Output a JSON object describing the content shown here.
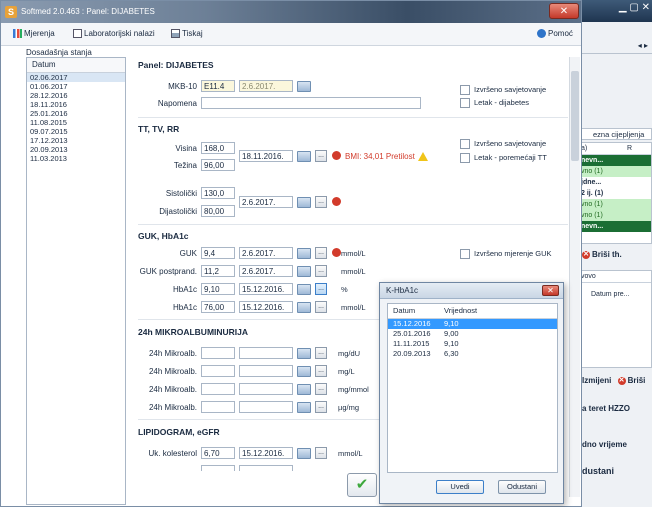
{
  "window": {
    "title": "Softmed 2.0.463 : Panel: DIJABETES",
    "close_label": "✕"
  },
  "toolbar": {
    "mjerenja": "Mjerenja",
    "laboratorijski": "Laboratorijski nalazi",
    "tiskaj": "Tiskaj",
    "pomoc": "Pomoć"
  },
  "history": {
    "title": "Dosadašnja stanja",
    "header": "Datum",
    "rows": [
      "02.06.2017",
      "01.06.2017",
      "28.12.2016",
      "18.11.2016",
      "25.01.2016",
      "11.08.2015",
      "09.07.2015",
      "17.12.2013",
      "20.09.2013",
      "11.03.2013"
    ]
  },
  "panel": {
    "title": "Panel: DIJABETES",
    "mkb_label": "MKB-10",
    "mkb_code": "E11.4",
    "mkb_date": "2.6.2017.",
    "napomena_label": "Napomena",
    "chk_savjetovanje": "Izvršeno savjetovanje",
    "chk_letak_dijabetes": "Letak - dijabetes"
  },
  "ttvrr": {
    "title": "TT, TV, RR",
    "visina_label": "Visina",
    "visina": "168,0",
    "tezina_label": "Težina",
    "tezina": "96,00",
    "date": "18.11.2016.",
    "bmi": "BMI: 34,01 Pretilost",
    "chk_savjetovanje": "Izvršeno savjetovanje",
    "chk_letak": "Letak - poremećaji TT",
    "sist_label": "Sistolički",
    "sist": "130,0",
    "dijast_label": "Dijastolički",
    "dijast": "80,00",
    "rr_date": "2.6.2017."
  },
  "guk": {
    "title": "GUK, HbA1c",
    "chk_mjerenje": "Izvršeno mjerenje GUK",
    "rows": [
      {
        "label": "GUK",
        "value": "9,4",
        "date": "2.6.2017.",
        "unit": "mmol/L"
      },
      {
        "label": "GUK postprand.",
        "value": "11,2",
        "date": "2.6.2017.",
        "unit": "mmol/L"
      },
      {
        "label": "HbA1c",
        "value": "9,10",
        "date": "15.12.2016.",
        "unit": "%"
      },
      {
        "label": "HbA1c",
        "value": "76,00",
        "date": "15.12.2016.",
        "unit": "mmol/L"
      }
    ]
  },
  "mikro": {
    "title": "24h MIKROALBUMINURIJA",
    "rows": [
      {
        "label": "24h Mikroalb.",
        "unit": "mg/dU"
      },
      {
        "label": "24h Mikroalb.",
        "unit": "mg/L"
      },
      {
        "label": "24h Mikroalb.",
        "unit": "mg/mmol"
      },
      {
        "label": "24h Mikroalb.",
        "unit": "µg/mg"
      }
    ]
  },
  "lipid": {
    "title": "LIPIDOGRAM, eGFR",
    "kol_label": "Uk. kolesterol",
    "kol_value": "6,70",
    "kol_date": "15.12.2016.",
    "kol_unit": "mmol/L"
  },
  "popup": {
    "title": "K-HbA1c",
    "close": "✕",
    "col_datum": "Datum",
    "col_vrijednost": "Vrijednost",
    "rows": [
      {
        "date": "15.12.2016",
        "value": "9,10"
      },
      {
        "date": "25.01.2016",
        "value": "9,00"
      },
      {
        "date": "11.11.2015",
        "value": "9,10"
      },
      {
        "date": "20.09.2013",
        "value": "6,30"
      }
    ],
    "uvedi": "Uvedi",
    "odustani": "Odustani"
  },
  "background": {
    "tab_label": "ezna cijepljenja",
    "col_a": "a)",
    "col_r": "R",
    "rows": [
      "nevn...",
      "vno (1)",
      "jdne...",
      "2 ij. (1)",
      "vno (1)",
      "vno (1)",
      "nevn..."
    ],
    "brisi": "Briši th.",
    "vovo": "vovo",
    "datum_pre": "Datum pre...",
    "izmijeni": "Izmijeni",
    "brisi2": "Briši",
    "teret": "a teret HZZO",
    "vrijeme": "dno vrijeme",
    "odustani": "dustani",
    "nav": "◂ ▸"
  }
}
